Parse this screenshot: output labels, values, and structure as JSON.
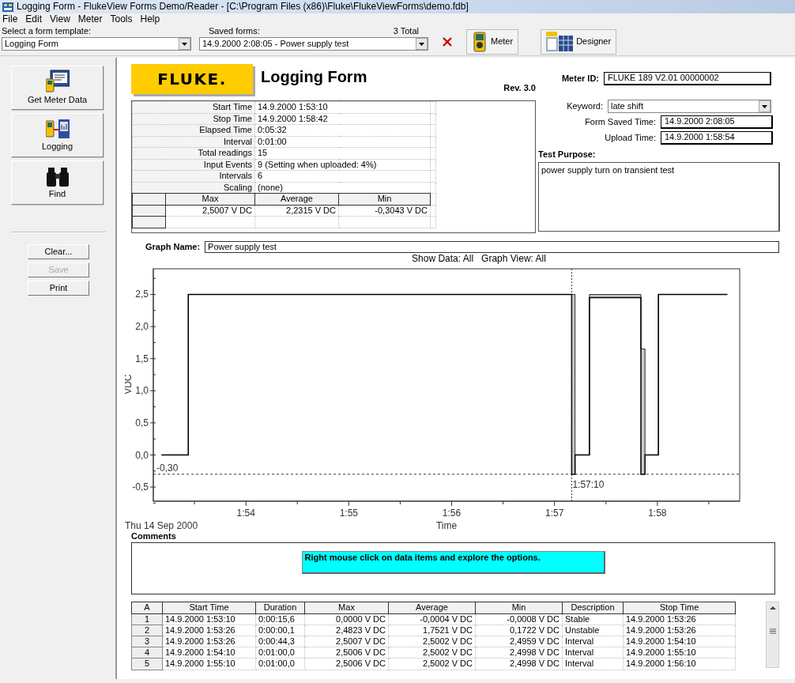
{
  "window": {
    "title": "Logging Form - FlukeView Forms Demo/Reader - [C:\\Program Files (x86)\\Fluke\\FlukeViewForms\\demo.fdb]"
  },
  "menu": [
    "File",
    "Edit",
    "View",
    "Meter",
    "Tools",
    "Help"
  ],
  "toolbar": {
    "template_label": "Select a form template:",
    "template_value": "Logging Form",
    "saved_label": "Saved forms:",
    "saved_count": "3 Total",
    "saved_value": "14.9.2000 2:08:05 - Power supply test",
    "buttons": [
      {
        "kind": "delete"
      },
      {
        "kind": "meter",
        "label": "Meter"
      },
      {
        "kind": "designer",
        "label": "Designer"
      }
    ]
  },
  "sidebar": {
    "tools": [
      {
        "kind": "meter-data",
        "label": "Get Meter Data"
      },
      {
        "kind": "logging",
        "label": "Logging"
      },
      {
        "kind": "find",
        "label": "Find"
      }
    ],
    "actions": [
      {
        "label": "Clear...",
        "disabled": false
      },
      {
        "label": "Save",
        "disabled": true
      },
      {
        "label": "Print",
        "disabled": false
      }
    ]
  },
  "form": {
    "logo": "FLUKE.",
    "title": "Logging Form",
    "revision": "Rev. 3.0",
    "summary": [
      {
        "label": "Start Time",
        "value": "14.9.2000 1:53:10"
      },
      {
        "label": "Stop Time",
        "value": "14.9.2000 1:58:42"
      },
      {
        "label": "Elapsed Time",
        "value": "0:05:32"
      },
      {
        "label": "Interval",
        "value": "0:01:00"
      },
      {
        "label": "Total readings",
        "value": "15"
      },
      {
        "label": "Input Events",
        "value": "9   (Setting when uploaded: 4%)"
      },
      {
        "label": "Intervals",
        "value": "6"
      },
      {
        "label": "Scaling",
        "value": "(none)"
      }
    ],
    "stats": {
      "columns": [
        "Max",
        "Average",
        "Min"
      ],
      "rows": [
        [
          "2,5007 V DC",
          "2,2315 V DC",
          "-0,3043 V DC"
        ]
      ]
    },
    "meter_id_label": "Meter ID:",
    "meter_id": "FLUKE 189   V2.01  00000002",
    "keyword_label": "Keyword:",
    "keyword": "late shift",
    "saved_time_label": "Form Saved Time:",
    "saved_time": "14.9.2000 2:08:05",
    "upload_label": "Upload Time:",
    "upload_time": "14.9.2000 1:58:54",
    "purpose_label": "Test Purpose:",
    "purpose": "power supply turn on transient test"
  },
  "graph": {
    "name_label": "Graph Name:",
    "name": "Power supply test",
    "view_info": "Show Data: All   Graph View: All",
    "date": "Thu 14 Sep 2000",
    "chart_data": {
      "type": "line",
      "xlabel": "Time",
      "ylabel": "VDC",
      "x": [
        113.18,
        113.44,
        113.44,
        117.1667,
        117.1667,
        117.2,
        117.2,
        117.34,
        117.34,
        117.84,
        117.84,
        117.88,
        117.88,
        118.01,
        118.01,
        118.68
      ],
      "series": [
        {
          "color": "#000000",
          "values": [
            0,
            0,
            2.5,
            2.5,
            2.5,
            2.5,
            0,
            0,
            2.5,
            2.5,
            1.65,
            1.65,
            0,
            0,
            2.5,
            2.5
          ]
        },
        {
          "color": "#000000",
          "values": [
            0,
            0,
            2.5,
            2.5,
            -0.3,
            -0.3,
            0,
            0,
            2.45,
            2.45,
            -0.3,
            -0.3,
            0,
            0,
            2.5,
            2.5
          ]
        }
      ],
      "xlim": [
        113.1,
        118.8
      ],
      "ylim": [
        -0.72,
        2.9
      ],
      "xticks": [
        {
          "value": 114,
          "label": "1:54"
        },
        {
          "value": 115,
          "label": "1:55"
        },
        {
          "value": 116,
          "label": "1:56"
        },
        {
          "value": 117,
          "label": "1:57"
        },
        {
          "value": 118,
          "label": "1:58"
        }
      ],
      "yticks": [
        {
          "value": -0.5,
          "label": "-0,5"
        },
        {
          "value": 0,
          "label": "0,0"
        },
        {
          "value": 0.5,
          "label": "0,5"
        },
        {
          "value": 1,
          "label": "1,0"
        },
        {
          "value": 1.5,
          "label": "1,5"
        },
        {
          "value": 2,
          "label": "2,0"
        },
        {
          "value": 2.5,
          "label": "2,5"
        }
      ],
      "ref_lines": [
        {
          "axis": "y",
          "value": -0.3,
          "label": "-0,30"
        },
        {
          "axis": "x",
          "value": 117.1667
        }
      ]
    },
    "cursor_label": "1:57:10"
  },
  "comments": {
    "label": "Comments",
    "note": "Right mouse click on data items and explore the options."
  },
  "events": {
    "columns": [
      "A",
      "Start Time",
      "Duration",
      "Max",
      "Average",
      "Min",
      "Description",
      "Stop Time"
    ],
    "rows": [
      [
        "1",
        "14.9.2000 1:53:10",
        "0:00:15,6",
        "0,0000 V DC",
        "-0,0004 V DC",
        "-0,0008 V DC",
        "Stable",
        "14.9.2000 1:53:26"
      ],
      [
        "2",
        "14.9.2000 1:53:26",
        "0:00:00,1",
        "2,4823 V DC",
        "1,7521 V DC",
        "0,1722 V DC",
        "Unstable",
        "14.9.2000 1:53:26"
      ],
      [
        "3",
        "14.9.2000 1:53:26",
        "0:00:44,3",
        "2,5007 V DC",
        "2,5002 V DC",
        "2,4959 V DC",
        "Interval",
        "14.9.2000 1:54:10"
      ],
      [
        "4",
        "14.9.2000 1:54:10",
        "0:01:00,0",
        "2,5006 V DC",
        "2,5002 V DC",
        "2,4998 V DC",
        "Interval",
        "14.9.2000 1:55:10"
      ],
      [
        "5",
        "14.9.2000 1:55:10",
        "0:01:00,0",
        "2,5006 V DC",
        "2,5002 V DC",
        "2,4998 V DC",
        "Interval",
        "14.9.2000 1:56:10"
      ]
    ]
  }
}
